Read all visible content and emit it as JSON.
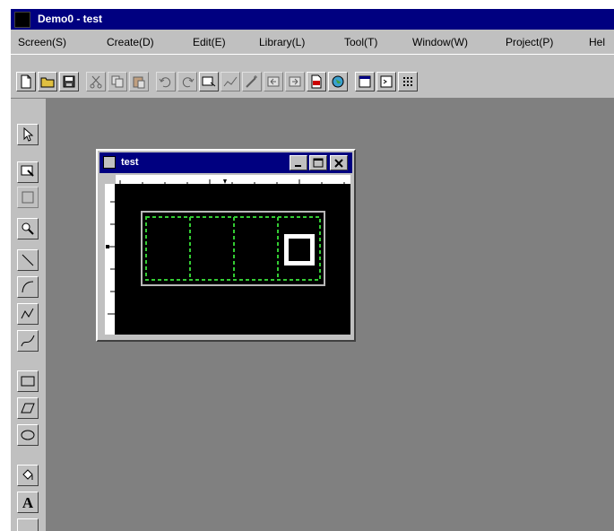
{
  "app": {
    "title": "Demo0 - test"
  },
  "menu": [
    "Screen(S)",
    "Create(D)",
    "Edit(E)",
    "Library(L)",
    "Tool(T)",
    "Window(W)",
    "Project(P)",
    "Hel"
  ],
  "toolbar_icons": [
    "new-file-icon",
    "open-folder-icon",
    "save-icon",
    "cut-icon",
    "copy-icon",
    "paste-icon",
    "undo-icon",
    "redo-icon",
    "screen-icon",
    "chart-icon",
    "wand-icon",
    "arrow-left-icon",
    "arrow-right-icon",
    "pdf-icon",
    "globe-icon",
    "window-icon",
    "console-icon",
    "grid-icon"
  ],
  "child_window": {
    "title": "test"
  },
  "display": {
    "value": "0",
    "digit_count": 4
  },
  "tools": [
    "select-arrow-icon",
    "edit-object-icon",
    "disabled-tool-icon",
    "zoom-tool-icon",
    "line-icon",
    "arc-icon",
    "polyline-icon",
    "curve-icon",
    "rectangle-icon",
    "parallelogram-icon",
    "ellipse-icon",
    "fill-icon"
  ],
  "text_tool_label": "A",
  "colors": {
    "titlebar": "#000080",
    "face": "#c0c0c0",
    "workspace": "#808080",
    "dashed_grid": "#33cc33",
    "digit": "#ffffff",
    "canvas": "#000000"
  }
}
